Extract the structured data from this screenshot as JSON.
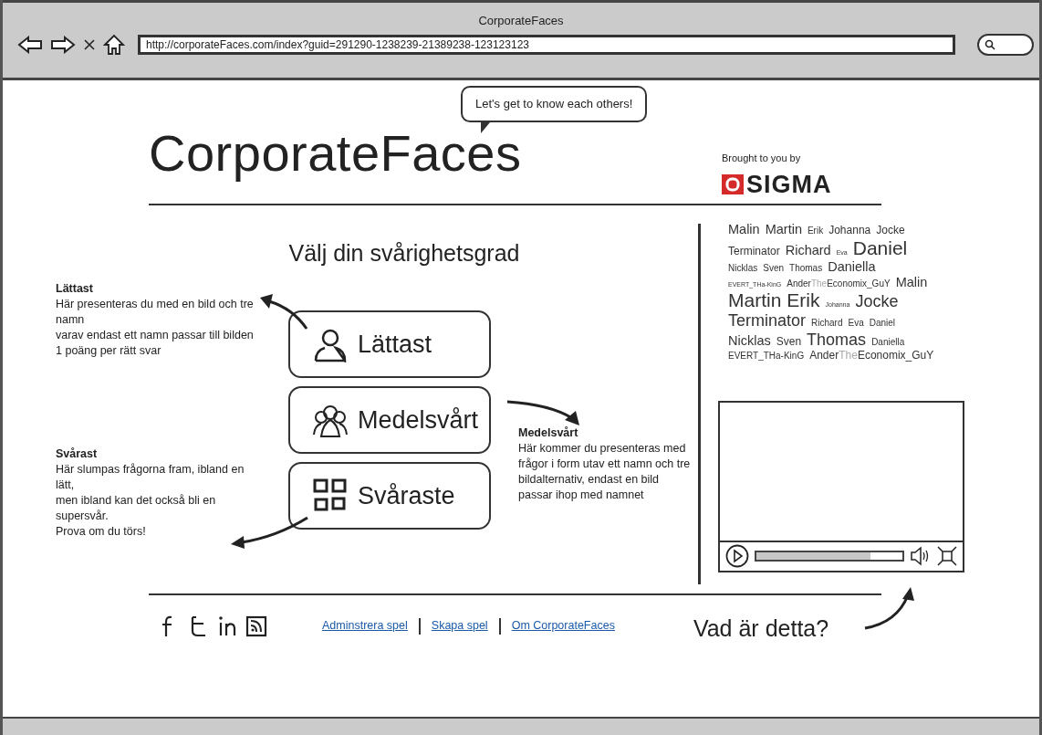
{
  "window": {
    "title": "CorporateFaces"
  },
  "address_bar": {
    "value": "http://corporateFaces.com/index?guid=291290-1238239-21389238-123123123"
  },
  "header": {
    "logo_text": "CorporateFaces",
    "speech_bubble": "Let's get to know each others!",
    "sponsor_label": "Brought to you by",
    "sponsor_name": "SIGMA"
  },
  "difficulty": {
    "title": "Välj din svårighetsgrad",
    "buttons": [
      {
        "label": "Lättast",
        "kind": "single"
      },
      {
        "label": "Medelsvårt",
        "kind": "group"
      },
      {
        "label": "Svåraste",
        "kind": "grid"
      }
    ],
    "descriptions": [
      {
        "heading": "Lättast",
        "lines": [
          "Här presenteras du med en bild och tre namn",
          "varav endast ett namn passar till bilden",
          "1 poäng per rätt svar"
        ]
      },
      {
        "heading": "Svårast",
        "lines": [
          "Här slumpas frågorna fram, ibland en lätt,",
          "men ibland kan det också bli en supersvår.",
          "Prova om du törs!"
        ]
      },
      {
        "heading": "Medelsvårt",
        "lines": [
          "Här kommer du presenteras med frågor i form utav ett namn och tre bildalternativ, endast en bild passar ihop med namnet"
        ]
      }
    ]
  },
  "tag_cloud": {
    "lines": [
      [
        {
          "kind": "m",
          "parts": [
            {
              "text": "Malin",
              "muted": false
            }
          ]
        },
        {
          "kind": "m",
          "parts": [
            {
              "text": "Martin",
              "muted": false
            }
          ]
        },
        {
          "kind": "xs",
          "parts": [
            {
              "text": "Erik",
              "muted": false
            }
          ]
        },
        {
          "kind": "s",
          "parts": [
            {
              "text": "Johanna",
              "muted": false
            }
          ]
        },
        {
          "kind": "s",
          "parts": [
            {
              "text": "Jocke",
              "muted": false
            }
          ]
        }
      ],
      [
        {
          "kind": "s",
          "parts": [
            {
              "text": "Terminator",
              "muted": false
            }
          ]
        },
        {
          "kind": "m",
          "parts": [
            {
              "text": "Richard",
              "muted": false
            }
          ]
        },
        {
          "kind": "xxs",
          "parts": [
            {
              "text": "Eva",
              "muted": false
            }
          ]
        },
        {
          "kind": "xl",
          "parts": [
            {
              "text": "Daniel",
              "muted": false
            }
          ]
        }
      ],
      [
        {
          "kind": "xs",
          "parts": [
            {
              "text": "Nicklas",
              "muted": false
            }
          ]
        },
        {
          "kind": "xs",
          "parts": [
            {
              "text": "Sven",
              "muted": false
            }
          ]
        },
        {
          "kind": "xs",
          "parts": [
            {
              "text": "Thomas",
              "muted": false
            }
          ]
        },
        {
          "kind": "m",
          "parts": [
            {
              "text": "Daniella",
              "muted": false
            }
          ]
        }
      ],
      [
        {
          "kind": "xxs",
          "parts": [
            {
              "text": "EVERT_THa-KinG",
              "muted": false
            }
          ]
        },
        {
          "kind": "xs",
          "parts": [
            {
              "text": "Ander",
              "muted": false
            },
            {
              "text": "The",
              "muted": true
            },
            {
              "text": "Economix_GuY",
              "muted": false
            }
          ]
        },
        {
          "kind": "m",
          "parts": [
            {
              "text": "Malin",
              "muted": false
            }
          ]
        }
      ],
      [
        {
          "kind": "xl",
          "parts": [
            {
              "text": "Martin",
              "muted": false
            }
          ]
        },
        {
          "kind": "xl",
          "parts": [
            {
              "text": "Erik",
              "muted": false
            }
          ]
        },
        {
          "kind": "xxs",
          "parts": [
            {
              "text": "Johanna",
              "muted": false
            }
          ]
        },
        {
          "kind": "l",
          "parts": [
            {
              "text": "Jocke",
              "muted": false
            }
          ]
        }
      ],
      [
        {
          "kind": "l",
          "parts": [
            {
              "text": "Terminator",
              "muted": false
            }
          ]
        },
        {
          "kind": "xs",
          "parts": [
            {
              "text": "Richard",
              "muted": false
            }
          ]
        },
        {
          "kind": "xs",
          "parts": [
            {
              "text": "Eva",
              "muted": false
            }
          ]
        },
        {
          "kind": "xs",
          "parts": [
            {
              "text": "Daniel",
              "muted": false
            }
          ]
        }
      ],
      [
        {
          "kind": "m",
          "parts": [
            {
              "text": "Nicklas",
              "muted": false
            }
          ]
        },
        {
          "kind": "s",
          "parts": [
            {
              "text": "Sven",
              "muted": false
            }
          ]
        },
        {
          "kind": "l",
          "parts": [
            {
              "text": "Thomas",
              "muted": false
            }
          ]
        },
        {
          "kind": "xs",
          "parts": [
            {
              "text": "Daniella",
              "muted": false
            }
          ]
        }
      ],
      [
        {
          "kind": "xs",
          "parts": [
            {
              "text": "EVERT_THa-KinG",
              "muted": false
            }
          ]
        },
        {
          "kind": "s",
          "parts": [
            {
              "text": "Ander",
              "muted": false
            },
            {
              "text": "The",
              "muted": true
            },
            {
              "text": "Economix_GuY",
              "muted": false
            }
          ]
        }
      ]
    ]
  },
  "video_player": {
    "level": 0.78
  },
  "footer": {
    "social": [
      {
        "kind": "facebook"
      },
      {
        "kind": "twitter"
      },
      {
        "kind": "linkedin"
      },
      {
        "kind": "rss"
      }
    ],
    "links": [
      "Adminstrera spel",
      "Skapa spel",
      "Om CorporateFaces"
    ],
    "help_text": "Vad är detta?"
  }
}
